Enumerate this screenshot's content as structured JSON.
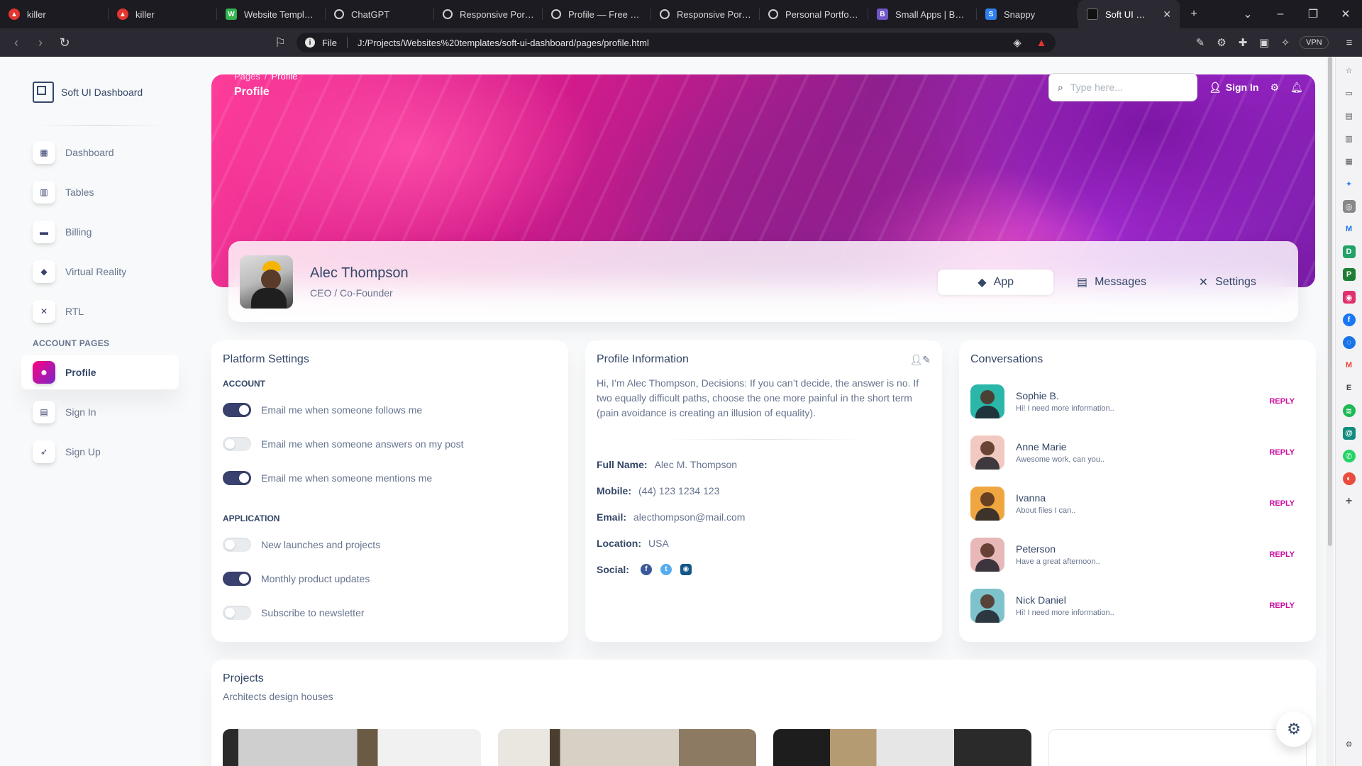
{
  "browser": {
    "tabs": [
      {
        "label": "killer",
        "icon": "brave-icon",
        "active": false
      },
      {
        "label": "killer",
        "icon": "brave-icon",
        "active": false
      },
      {
        "label": "Website Templates",
        "icon": "template-icon",
        "active": false
      },
      {
        "label": "ChatGPT",
        "icon": "chatgpt-icon",
        "active": false
      },
      {
        "label": "Responsive Portfoli",
        "icon": "globe-icon",
        "active": false
      },
      {
        "label": "Profile — Free Web",
        "icon": "globe-icon",
        "active": false
      },
      {
        "label": "Responsive Portfoli",
        "icon": "globe-icon",
        "active": false
      },
      {
        "label": "Personal Portfolio V",
        "icon": "globe-icon",
        "active": false
      },
      {
        "label": "Small Apps | Bootst",
        "icon": "bootstrap-icon",
        "active": false
      },
      {
        "label": "Snappy",
        "icon": "snappy-icon",
        "active": false
      },
      {
        "label": "Soft UI Dashbo",
        "icon": "soft-ui-icon",
        "active": true
      }
    ],
    "url_scheme": "File",
    "url": "J:/Projects/Websites%20templates/soft-ui-dashboard/pages/profile.html",
    "vpn_label": "VPN"
  },
  "sidebar": {
    "brand": "Soft UI Dashboard",
    "items": [
      {
        "label": "Dashboard",
        "icon": "shop-icon"
      },
      {
        "label": "Tables",
        "icon": "office-icon"
      },
      {
        "label": "Billing",
        "icon": "credit-card-icon"
      },
      {
        "label": "Virtual Reality",
        "icon": "box-3d-icon"
      },
      {
        "label": "RTL",
        "icon": "settings-tools-icon"
      }
    ],
    "section_title": "ACCOUNT PAGES",
    "account_items": [
      {
        "label": "Profile",
        "icon": "customer-support-icon",
        "active": true
      },
      {
        "label": "Sign In",
        "icon": "document-icon"
      },
      {
        "label": "Sign Up",
        "icon": "spaceship-icon"
      }
    ]
  },
  "header": {
    "breadcrumb_root": "Pages",
    "breadcrumb_current": "Profile",
    "page_title": "Profile",
    "search_placeholder": "Type here...",
    "sign_in": "Sign In"
  },
  "profile": {
    "name": "Alec Thompson",
    "role": "CEO / Co-Founder",
    "tabs": [
      {
        "label": "App",
        "active": true
      },
      {
        "label": "Messages",
        "active": false
      },
      {
        "label": "Settings",
        "active": false
      }
    ]
  },
  "platform_settings": {
    "title": "Platform Settings",
    "account_title": "ACCOUNT",
    "account": [
      {
        "label": "Email me when someone follows me",
        "on": true
      },
      {
        "label": "Email me when someone answers on my post",
        "on": false
      },
      {
        "label": "Email me when someone mentions me",
        "on": true
      }
    ],
    "application_title": "APPLICATION",
    "application": [
      {
        "label": "New launches and projects",
        "on": false
      },
      {
        "label": "Monthly product updates",
        "on": true
      },
      {
        "label": "Subscribe to newsletter",
        "on": false
      }
    ]
  },
  "profile_info": {
    "title": "Profile Information",
    "description": "Hi, I’m Alec Thompson, Decisions: If you can’t decide, the answer is no. If two equally difficult paths, choose the one more painful in the short term (pain avoidance is creating an illusion of equality).",
    "fields": [
      {
        "label": "Full Name:",
        "value": "Alec M. Thompson"
      },
      {
        "label": "Mobile:",
        "value": "(44) 123 1234 123"
      },
      {
        "label": "Email:",
        "value": "alecthompson@mail.com"
      },
      {
        "label": "Location:",
        "value": "USA"
      }
    ],
    "social_label": "Social:"
  },
  "conversations": {
    "title": "Conversations",
    "reply_label": "REPLY",
    "items": [
      {
        "name": "Sophie B.",
        "message": "Hi! I need more information..",
        "color": "#2ab7a9"
      },
      {
        "name": "Anne Marie",
        "message": "Awesome work, can you..",
        "color": "#f2c9c0"
      },
      {
        "name": "Ivanna",
        "message": "About files I can..",
        "color": "#f0a640"
      },
      {
        "name": "Peterson",
        "message": "Have a great afternoon..",
        "color": "#e8b7b7"
      },
      {
        "name": "Nick Daniel",
        "message": "Hi! I need more information..",
        "color": "#7ec3cc"
      }
    ]
  },
  "projects": {
    "title": "Projects",
    "subtitle": "Architects design houses"
  },
  "colors": {
    "primary_gradient_start": "#7928ca",
    "primary_gradient_end": "#ff0080",
    "dark": "#344767",
    "switch_on": "#3a416f",
    "reply": "#cb0c9f"
  }
}
